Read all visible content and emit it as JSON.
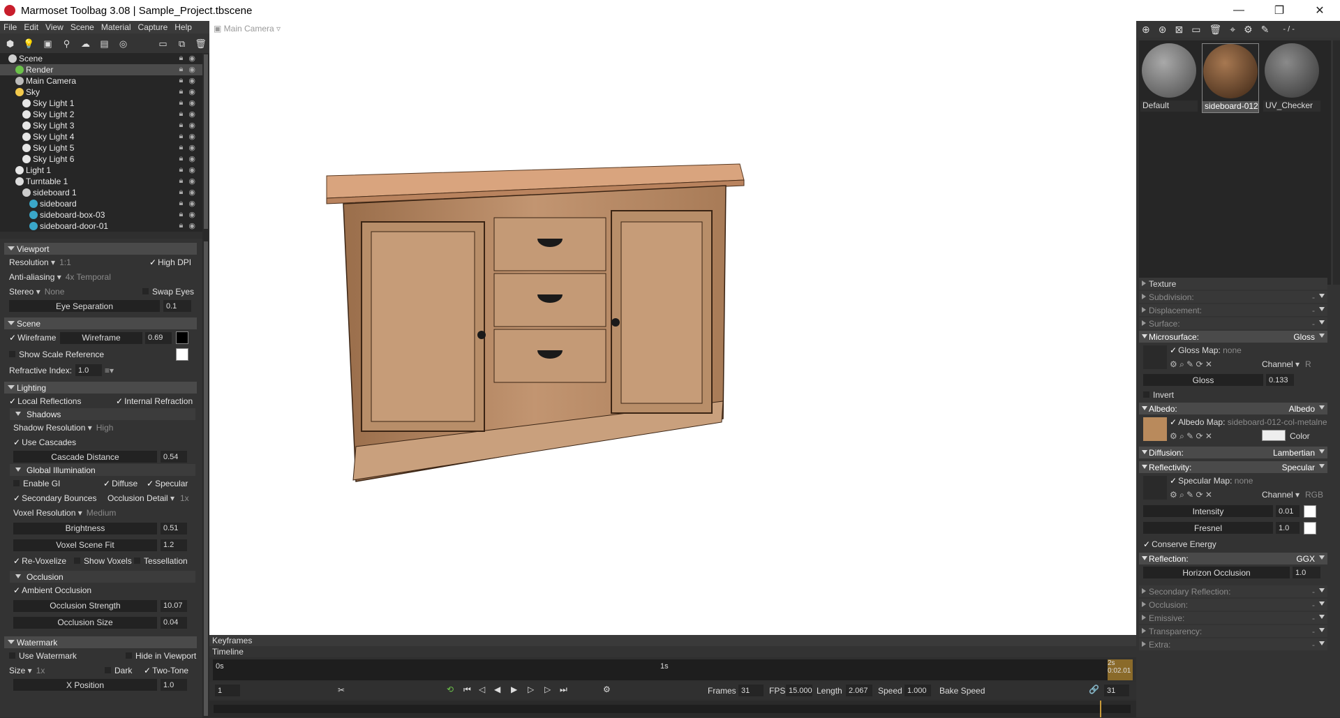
{
  "window": {
    "title": "Marmoset Toolbag 3.08  |  Sample_Project.tbscene",
    "min": "—",
    "max": "❐",
    "close": "✕"
  },
  "menu": [
    "File",
    "Edit",
    "View",
    "Scene",
    "Material",
    "Capture",
    "Help"
  ],
  "scene_tree": [
    {
      "label": "Scene",
      "indent": 0,
      "icon": "scene-icon",
      "color": "#cfcfcf"
    },
    {
      "label": "Render",
      "indent": 1,
      "icon": "render-icon",
      "color": "#6cc24a",
      "selected": true
    },
    {
      "label": "Main Camera",
      "indent": 1,
      "icon": "camera-icon",
      "color": "#bbbbbb"
    },
    {
      "label": "Sky",
      "indent": 1,
      "icon": "sky-icon",
      "color": "#f2c94c"
    },
    {
      "label": "Sky Light 1",
      "indent": 2,
      "icon": "light-icon",
      "color": "#e6e6e6"
    },
    {
      "label": "Sky Light 2",
      "indent": 2,
      "icon": "light-icon",
      "color": "#e6e6e6"
    },
    {
      "label": "Sky Light 3",
      "indent": 2,
      "icon": "light-icon",
      "color": "#e6e6e6"
    },
    {
      "label": "Sky Light 4",
      "indent": 2,
      "icon": "light-icon",
      "color": "#e6e6e6"
    },
    {
      "label": "Sky Light 5",
      "indent": 2,
      "icon": "light-icon",
      "color": "#e6e6e6"
    },
    {
      "label": "Sky Light 6",
      "indent": 2,
      "icon": "light-icon",
      "color": "#e6e6e6"
    },
    {
      "label": "Light 1",
      "indent": 1,
      "icon": "light-icon",
      "color": "#e6e6e6"
    },
    {
      "label": "Turntable 1",
      "indent": 1,
      "icon": "turntable-icon",
      "color": "#dddddd"
    },
    {
      "label": "sideboard 1",
      "indent": 2,
      "icon": "model-icon",
      "color": "#cccccc"
    },
    {
      "label": "sideboard",
      "indent": 3,
      "icon": "mesh-icon",
      "color": "#3aa7c9"
    },
    {
      "label": "sideboard-box-03",
      "indent": 3,
      "icon": "mesh-icon",
      "color": "#3aa7c9"
    },
    {
      "label": "sideboard-door-01",
      "indent": 3,
      "icon": "mesh-icon",
      "color": "#3aa7c9"
    }
  ],
  "viewport_panel": {
    "header": "Viewport",
    "resolution_label": "Resolution",
    "resolution_value": "1:1",
    "high_dpi": "High DPI",
    "aa_label": "Anti-aliasing",
    "aa_value": "4x Temporal",
    "stereo_label": "Stereo",
    "stereo_value": "None",
    "swap_eyes": "Swap Eyes",
    "eye_sep": "Eye Separation",
    "eye_sep_value": "0.1"
  },
  "scene_panel": {
    "header": "Scene",
    "wireframe": "Wireframe",
    "wireframe_slider": "Wireframe",
    "wireframe_value": "0.69",
    "show_scale": "Show Scale Reference",
    "refractive": "Refractive Index:",
    "refractive_value": "1.0"
  },
  "lighting_panel": {
    "header": "Lighting",
    "local_refl": "Local Reflections",
    "internal_refr": "Internal Refraction",
    "shadows": "Shadows",
    "shadow_res": "Shadow Resolution",
    "shadow_res_value": "High",
    "use_cascades": "Use Cascades",
    "cascade_dist": "Cascade Distance",
    "cascade_dist_value": "0.54",
    "gi": "Global Illumination",
    "enable_gi": "Enable GI",
    "diffuse": "Diffuse",
    "specular": "Specular",
    "secondary": "Secondary Bounces",
    "occ_detail": "Occlusion Detail",
    "occ_detail_value": "1x",
    "voxel_res": "Voxel Resolution",
    "voxel_res_value": "Medium",
    "brightness": "Brightness",
    "brightness_value": "0.51",
    "voxel_fit": "Voxel Scene Fit",
    "voxel_fit_value": "1.2",
    "revoxelize": "Re-Voxelize",
    "show_voxels": "Show Voxels",
    "tessellation": "Tessellation",
    "occlusion": "Occlusion",
    "ambient_occ": "Ambient Occlusion",
    "occ_strength": "Occlusion Strength",
    "occ_strength_value": "10.07",
    "occ_size": "Occlusion Size",
    "occ_size_value": "0.04"
  },
  "watermark_panel": {
    "header": "Watermark",
    "use": "Use Watermark",
    "hide": "Hide in Viewport",
    "size": "Size",
    "size_value": "1x",
    "dark": "Dark",
    "two_tone": "Two-Tone",
    "xpos": "X Position",
    "xpos_value": "1.0"
  },
  "viewport": {
    "camera": "Main Camera"
  },
  "timeline": {
    "keyframes": "Keyframes",
    "timeline": "Timeline",
    "t0": "0s",
    "t1": "1s",
    "t2": "2s",
    "t_end": "0:02.01",
    "frame": "1",
    "frames_label": "Frames",
    "frames": "31",
    "fps_label": "FPS",
    "fps": "15.000",
    "length_label": "Length",
    "length": "2.067",
    "speed_label": "Speed",
    "speed": "1.000",
    "bake_speed": "Bake Speed",
    "end_frame": "31"
  },
  "materials": {
    "counter": "- / -",
    "items": [
      {
        "name": "Default",
        "color": "#6c6c6c"
      },
      {
        "name": "sideboard-012",
        "color": "#7a5237"
      },
      {
        "name": "UV_Checker",
        "color": "#5a5a5a"
      }
    ]
  },
  "material_props": {
    "texture": "Texture",
    "subdivision": "Subdivision:",
    "displacement": "Displacement:",
    "surface": "Surface:",
    "microsurface": "Microsurface:",
    "microsurface_value": "Gloss",
    "gloss_map": "Gloss Map:",
    "gloss_map_value": "none",
    "channel": "Channel",
    "channel_r": "R",
    "gloss": "Gloss",
    "gloss_value": "0.133",
    "invert": "Invert",
    "albedo": "Albedo:",
    "albedo_value": "Albedo",
    "albedo_map": "Albedo Map:",
    "albedo_map_value": "sideboard-012-col-metalne",
    "color": "Color",
    "diffusion": "Diffusion:",
    "diffusion_value": "Lambertian",
    "reflectivity": "Reflectivity:",
    "reflectivity_value": "Specular",
    "spec_map": "Specular Map:",
    "spec_map_value": "none",
    "channel_rgb": "RGB",
    "intensity": "Intensity",
    "intensity_value": "0.01",
    "fresnel": "Fresnel",
    "fresnel_value": "1.0",
    "conserve": "Conserve Energy",
    "reflection": "Reflection:",
    "reflection_value": "GGX",
    "horizon": "Horizon Occlusion",
    "horizon_value": "1.0",
    "secondary_refl": "Secondary Reflection:",
    "occlusion": "Occlusion:",
    "emissive": "Emissive:",
    "transparency": "Transparency:",
    "extra": "Extra:",
    "dash": "-"
  }
}
